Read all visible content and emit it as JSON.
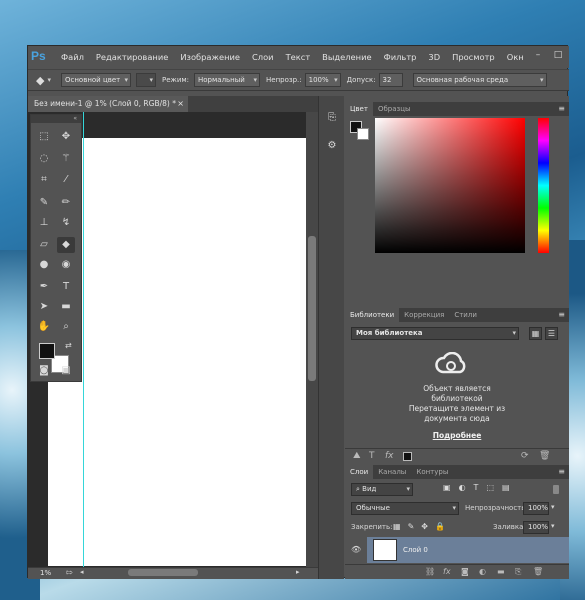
{
  "app": {
    "logo": "Ps"
  },
  "menu": [
    "Файл",
    "Редактирование",
    "Изображение",
    "Слои",
    "Текст",
    "Выделение",
    "Фильтр",
    "3D",
    "Просмотр",
    "Окн"
  ],
  "window_controls": [
    "–",
    "□"
  ],
  "options": {
    "preset": "Основной цвет",
    "mode_label": "Режим:",
    "mode_value": "Нормальный",
    "opacity_label": "Непрозр.:",
    "opacity_value": "100%",
    "tolerance_label": "Допуск:",
    "tolerance_value": "32",
    "workspace": "Основная рабочая среда"
  },
  "document": {
    "tab_title": "Без имени-1 @ 1% (Слой 0, RGB/8) *",
    "close": "×",
    "zoom": "1%"
  },
  "tools": [
    {
      "name": "marquee-tool-icon",
      "glyph": "⬚"
    },
    {
      "name": "move-tool-icon",
      "glyph": "✥"
    },
    {
      "name": "lasso-tool-icon",
      "glyph": "◌"
    },
    {
      "name": "magic-wand-icon",
      "glyph": "⚚"
    },
    {
      "name": "crop-tool-icon",
      "glyph": "⌗"
    },
    {
      "name": "eyedropper-icon",
      "glyph": "⁄"
    },
    {
      "name": "healing-brush-icon",
      "glyph": "✎"
    },
    {
      "name": "brush-tool-icon",
      "glyph": "✏"
    },
    {
      "name": "stamp-tool-icon",
      "glyph": "⊥"
    },
    {
      "name": "history-brush-icon",
      "glyph": "↯"
    },
    {
      "name": "eraser-tool-icon",
      "glyph": "▱"
    },
    {
      "name": "paint-bucket-icon",
      "glyph": "◆"
    },
    {
      "name": "blur-tool-icon",
      "glyph": "●"
    },
    {
      "name": "dodge-tool-icon",
      "glyph": "◉"
    },
    {
      "name": "pen-tool-icon",
      "glyph": "✒"
    },
    {
      "name": "type-tool-icon",
      "glyph": "T"
    },
    {
      "name": "path-select-icon",
      "glyph": "➤"
    },
    {
      "name": "shape-tool-icon",
      "glyph": "▬"
    },
    {
      "name": "hand-tool-icon",
      "glyph": "✋"
    },
    {
      "name": "zoom-tool-icon",
      "glyph": "🔍"
    }
  ],
  "panels": {
    "color": {
      "tabs": [
        "Цвет",
        "Образцы"
      ]
    },
    "libraries": {
      "tabs": [
        "Библиотеки",
        "Коррекция",
        "Стили"
      ],
      "selected": "Моя библиотека",
      "message": [
        "Объект является",
        "библиотекой",
        "Перетащите элемент из",
        "документа сюда"
      ],
      "more_link": "Подробнее"
    },
    "layers": {
      "tabs": [
        "Слои",
        "Каналы",
        "Контуры"
      ],
      "kind_filter": "Вид",
      "blend_mode": "Обычные",
      "opacity_label": "Непрозрачность:",
      "opacity_value": "100%",
      "lock_label": "Закрепить:",
      "fill_label": "Заливка:",
      "fill_value": "100%",
      "layers": [
        {
          "name": "Слой 0"
        }
      ]
    }
  }
}
